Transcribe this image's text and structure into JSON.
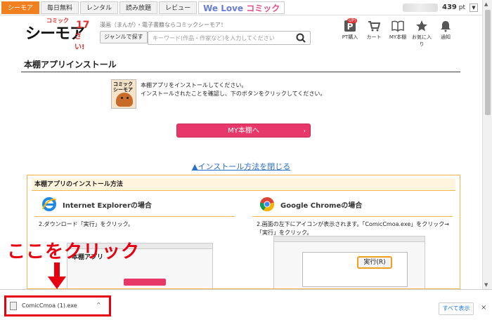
{
  "topnav": {
    "tabs": [
      "シーモア",
      "毎日無料",
      "レンタル",
      "読み放題",
      "レビュー"
    ],
    "banner_a": "We Love",
    "banner_b": "コミック",
    "points": "439",
    "points_unit": "pt"
  },
  "header": {
    "logo_main": "シーモア",
    "logo_small": "コミック",
    "logo_num": "17",
    "logo_num2": "さい!",
    "tagline": "漫画（まんが）・電子書籍ならコミックシーモア！",
    "genre_button": "ジャンルで探す",
    "search_placeholder": "キーワード(作品・作家など)を入力してください",
    "icons": [
      {
        "label": "PT購入",
        "icon": "parking-icon"
      },
      {
        "label": "カート",
        "icon": "cart-icon"
      },
      {
        "label": "MY本棚",
        "icon": "book-icon"
      },
      {
        "label": "お気に入り",
        "icon": "star-icon"
      },
      {
        "label": "通知",
        "icon": "bell-icon"
      }
    ],
    "pt_badge": "UP!"
  },
  "main": {
    "title": "本棚アプリインストール",
    "app_icon_text": "コミック シーモア",
    "info_line1": "本棚アプリをインストールしてください。",
    "info_line2": "インストールされたことを確認し、下のボタンをクリックしてください。",
    "my_button": "MY本棚へ",
    "close_link": "▲インストール方法を閉じる"
  },
  "install": {
    "heading": "本棚アプリのインストール方法",
    "ie_title": "Internet Explorerの場合",
    "ie_desc": "2.ダウンロード「実行」をクリック。",
    "chrome_title": "Google Chromeの場合",
    "chrome_desc": "2.画面の左下にアイコンが表示されます。「ComicCmoa.exe」をクリック→「実行」をクリック。",
    "shot_left_title": "本棚アプリ",
    "shot_right_run": "実行(R)"
  },
  "annotation": "ここをクリック",
  "download": {
    "filename": "ComicCmoa (1).exe",
    "show_all": "すべて表示",
    "close": "×"
  }
}
